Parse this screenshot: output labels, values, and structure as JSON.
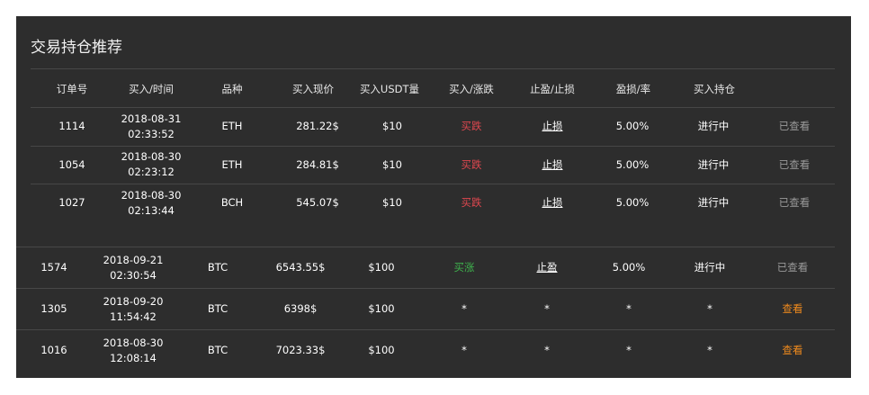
{
  "title": "交易持仓推荐",
  "headers": [
    "订单号",
    "买入/时间",
    "品种",
    "买入现价",
    "买入USDT量",
    "买入/涨跌",
    "止盈/止损",
    "盈损/率",
    "买入持仓"
  ],
  "rows_a": [
    {
      "id": "1114",
      "date": "2018-08-31",
      "time": "02:33:52",
      "coin": "ETH",
      "price": "281.22$",
      "qty": "$10",
      "dir": "买跌",
      "stop": "止损",
      "rate": "5.00%",
      "hold": "进行中",
      "action": "已查看"
    },
    {
      "id": "1054",
      "date": "2018-08-30",
      "time": "02:23:12",
      "coin": "ETH",
      "price": "284.81$",
      "qty": "$10",
      "dir": "买跌",
      "stop": "止损",
      "rate": "5.00%",
      "hold": "进行中",
      "action": "已查看"
    },
    {
      "id": "1027",
      "date": "2018-08-30",
      "time": "02:13:44",
      "coin": "BCH",
      "price": "545.07$",
      "qty": "$10",
      "dir": "买跌",
      "stop": "止损",
      "rate": "5.00%",
      "hold": "进行中",
      "action": "已查看"
    }
  ],
  "rows_b": [
    {
      "id": "1574",
      "date": "2018-09-21",
      "time": "02:30:54",
      "coin": "BTC",
      "price": "6543.55$",
      "qty": "$100",
      "dir": "买涨",
      "stop": "止盈",
      "rate": "5.00%",
      "hold": "进行中",
      "action": "已查看"
    },
    {
      "id": "1305",
      "date": "2018-09-20",
      "time": "11:54:42",
      "coin": "BTC",
      "price": "6398$",
      "qty": "$100",
      "dir": "*",
      "stop": "*",
      "rate": "*",
      "hold": "*",
      "action": "查看"
    },
    {
      "id": "1016",
      "date": "2018-08-30",
      "time": "12:08:14",
      "coin": "BTC",
      "price": "7023.33$",
      "qty": "$100",
      "dir": "*",
      "stop": "*",
      "rate": "*",
      "hold": "*",
      "action": "查看"
    }
  ],
  "colors": {
    "panel_bg": "#2d2d2d",
    "down": "#e0474f",
    "up": "#3fb24d",
    "view": "#f08a1d",
    "viewed": "#9a9a9a"
  }
}
